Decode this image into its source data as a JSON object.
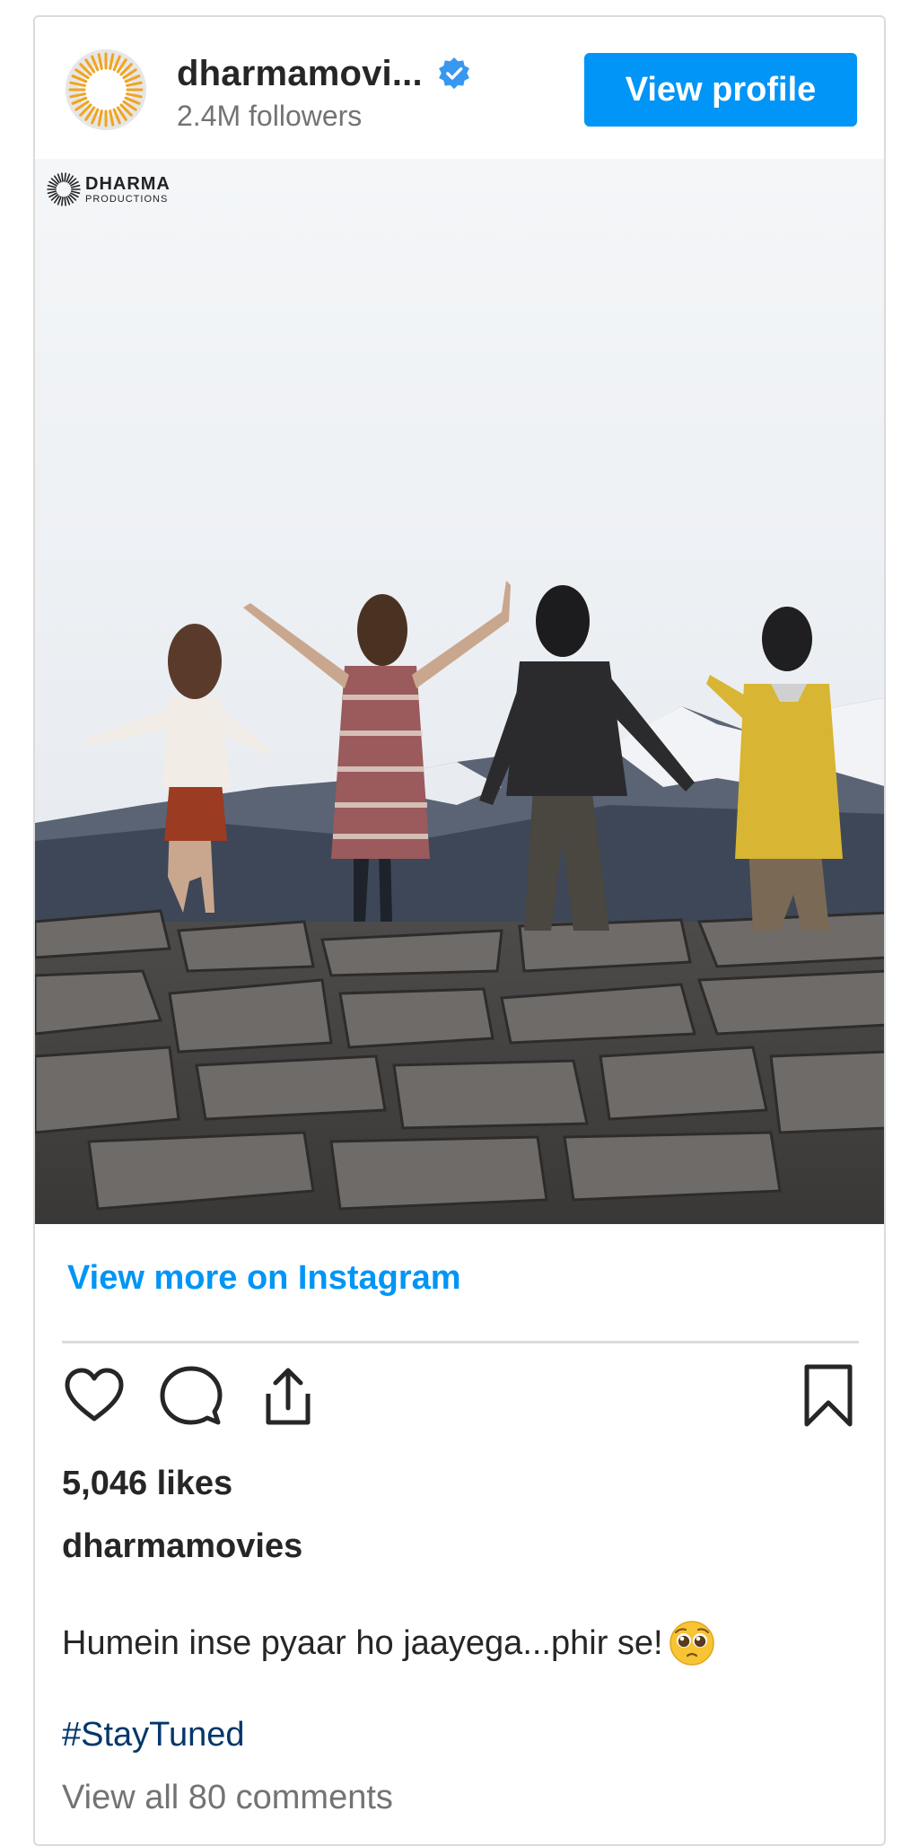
{
  "header": {
    "username": "dharmamovi...",
    "followers": "2.4M followers",
    "view_profile_label": "View profile",
    "verified_icon": "verified-badge-icon",
    "brand_color": "#0095f6"
  },
  "photo": {
    "watermark_brand": "DHARMA",
    "watermark_sub": "PRODUCTIONS"
  },
  "links": {
    "view_more": "View more on Instagram"
  },
  "actions": {
    "like_icon": "heart-icon",
    "comment_icon": "comment-icon",
    "share_icon": "share-icon",
    "save_icon": "bookmark-icon"
  },
  "post": {
    "likes": "5,046 likes",
    "owner": "dharmamovies",
    "caption": "Humein inse pyaar ho jaayega...phir se!",
    "caption_emoji": "pleading-face-emoji",
    "hashtag": "#StayTuned",
    "comments": "View all 80 comments"
  }
}
